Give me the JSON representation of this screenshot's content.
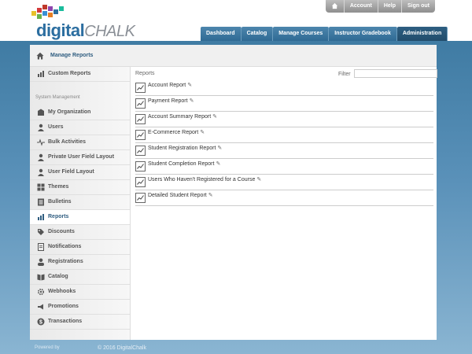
{
  "brand": {
    "digital": "digital",
    "chalk": "CHALK"
  },
  "topnav": {
    "home_icon": "home-icon",
    "account": "Account",
    "help": "Help",
    "signout": "Sign out"
  },
  "mainnav": [
    "Dashboard",
    "Catalog",
    "Manage Courses",
    "Instructor Gradebook",
    "Administration"
  ],
  "mainnav_active": "Administration",
  "breadcrumb": {
    "label": "Manage Reports"
  },
  "sidebar": {
    "top_item": {
      "label": "Custom Reports",
      "icon": "bar-chart-icon"
    },
    "section_label": "System Management",
    "items": [
      {
        "label": "My Organization",
        "icon": "building-icon"
      },
      {
        "label": "Users",
        "icon": "user-icon"
      },
      {
        "label": "Bulk Activities",
        "icon": "pulse-icon"
      },
      {
        "label": "Private User Field Layout",
        "icon": "user-icon"
      },
      {
        "label": "User Field Layout",
        "icon": "user-icon"
      },
      {
        "label": "Themes",
        "icon": "grid-icon"
      },
      {
        "label": "Bulletins",
        "icon": "list-icon"
      },
      {
        "label": "Reports",
        "icon": "bar-chart-icon",
        "active": true
      },
      {
        "label": "Discounts",
        "icon": "tag-icon"
      },
      {
        "label": "Notifications",
        "icon": "document-icon"
      },
      {
        "label": "Registrations",
        "icon": "person-icon"
      },
      {
        "label": "Catalog",
        "icon": "book-icon"
      },
      {
        "label": "Webhooks",
        "icon": "gear-icon"
      },
      {
        "label": "Promotions",
        "icon": "megaphone-icon"
      },
      {
        "label": "Transactions",
        "icon": "dollar-icon"
      }
    ]
  },
  "content": {
    "header": "Reports",
    "filter_label": "Filter",
    "filter_value": "",
    "reports": [
      "Account Report",
      "Payment Report",
      "Account Summary Report",
      "E-Commerce Report",
      "Student Registration Report",
      "Student Completion Report",
      "Users Who Haven't Registered for a Course",
      "Detailed Student Report"
    ]
  },
  "footer": {
    "powered_by": "Powered by",
    "copyright": "© 2016 DigitalChalk"
  },
  "colors": {
    "accent": "#2f6a94",
    "active_tab": "#214c6b",
    "background_gradient_top": "#3f7ba3"
  }
}
